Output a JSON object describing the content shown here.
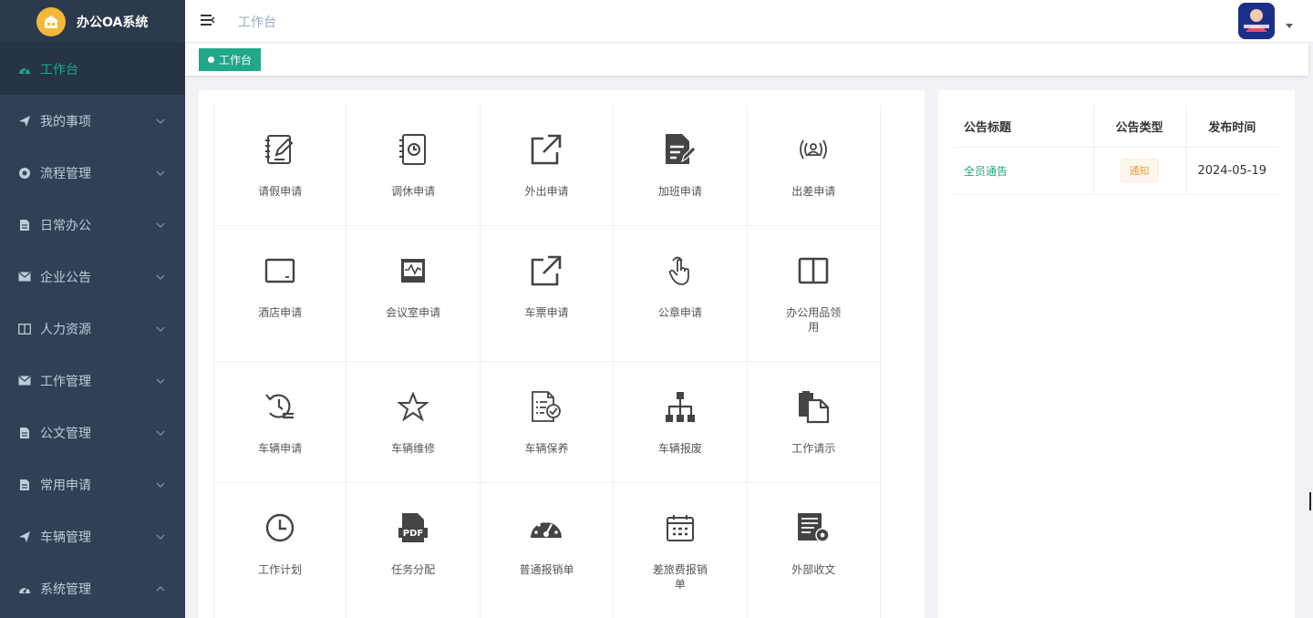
{
  "app": {
    "title": "办公OA系统"
  },
  "sidebar": {
    "items": [
      {
        "label": "工作台",
        "icon": "dashboard-icon",
        "active": true
      },
      {
        "label": "我的事项",
        "icon": "send-icon"
      },
      {
        "label": "流程管理",
        "icon": "flow-icon"
      },
      {
        "label": "日常办公",
        "icon": "document-icon"
      },
      {
        "label": "企业公告",
        "icon": "mail-icon"
      },
      {
        "label": "人力资源",
        "icon": "book-icon"
      },
      {
        "label": "工作管理",
        "icon": "mail-icon"
      },
      {
        "label": "公文管理",
        "icon": "document-icon"
      },
      {
        "label": "常用申请",
        "icon": "document-icon"
      },
      {
        "label": "车辆管理",
        "icon": "send-icon"
      },
      {
        "label": "系统管理",
        "icon": "dashboard-icon"
      }
    ]
  },
  "navbar": {
    "breadcrumb": "工作台"
  },
  "tags": {
    "active": "工作台"
  },
  "apps": [
    {
      "label": "请假申请",
      "icon": "leave-request-icon"
    },
    {
      "label": "调休申请",
      "icon": "time-off-icon"
    },
    {
      "label": "外出申请",
      "icon": "external-link-icon"
    },
    {
      "label": "加班申请",
      "icon": "overtime-doc-icon"
    },
    {
      "label": "出差申请",
      "icon": "broadcast-user-icon"
    },
    {
      "label": "酒店申请",
      "icon": "hotel-frame-icon"
    },
    {
      "label": "会议室申请",
      "icon": "monitor-chart-icon"
    },
    {
      "label": "车票申请",
      "icon": "external-link-icon"
    },
    {
      "label": "公章申请",
      "icon": "hand-pointer-icon"
    },
    {
      "label": "办公用品领用",
      "icon": "columns-icon"
    },
    {
      "label": "车辆申请",
      "icon": "history-list-icon"
    },
    {
      "label": "车辆维修",
      "icon": "star-icon"
    },
    {
      "label": "车辆保养",
      "icon": "checklist-icon"
    },
    {
      "label": "车辆报废",
      "icon": "org-chart-icon"
    },
    {
      "label": "工作请示",
      "icon": "copy-docs-icon"
    },
    {
      "label": "工作计划",
      "icon": "clock-icon"
    },
    {
      "label": "任务分配",
      "icon": "pdf-icon"
    },
    {
      "label": "普通报销单",
      "icon": "gauge-icon"
    },
    {
      "label": "差旅费报销单",
      "icon": "calendar-icon"
    },
    {
      "label": "外部收文",
      "icon": "doc-settings-icon"
    }
  ],
  "notices": {
    "headers": [
      "公告标题",
      "公告类型",
      "发布时间"
    ],
    "rows": [
      {
        "title": "全员通告",
        "type": "通知",
        "date": "2024-05-19"
      }
    ]
  },
  "colors": {
    "accent": "#1fa88a",
    "sidebar": "#304156",
    "warning": "#e6a23c"
  }
}
